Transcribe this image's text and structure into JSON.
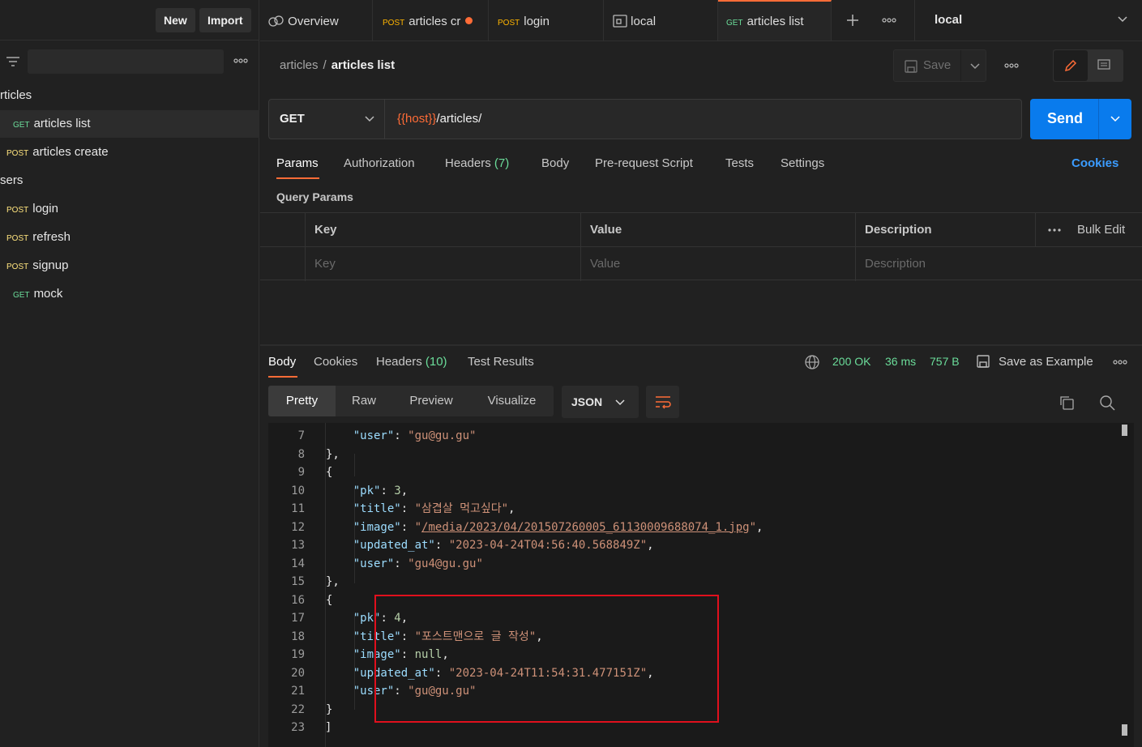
{
  "sidebar": {
    "new_label": "New",
    "import_label": "Import",
    "items": [
      {
        "label": "rticles",
        "method": ""
      },
      {
        "label": "articles list",
        "method": "GET"
      },
      {
        "label": "articles create",
        "method": "POST"
      },
      {
        "label": "sers",
        "method": ""
      },
      {
        "label": "login",
        "method": "POST"
      },
      {
        "label": "refresh",
        "method": "POST"
      },
      {
        "label": "signup",
        "method": "POST"
      },
      {
        "label": "mock",
        "method": "GET"
      }
    ]
  },
  "tabs": [
    {
      "method": "",
      "label": "Overview"
    },
    {
      "method": "POST",
      "label": "articles cr"
    },
    {
      "method": "POST",
      "label": "login"
    },
    {
      "method": "",
      "label": "local"
    },
    {
      "method": "GET",
      "label": "articles list"
    }
  ],
  "environment": "local",
  "breadcrumb": {
    "parent": "articles",
    "separator": "/",
    "current": "articles list"
  },
  "request": {
    "save_label": "Save",
    "method": "GET",
    "url_var": "{{host}}",
    "url_path": "/articles/",
    "send_label": "Send",
    "tabs": [
      "Params",
      "Authorization",
      "Headers",
      "(7)",
      "Body",
      "Pre-request Script",
      "Tests",
      "Settings"
    ],
    "cookies_label": "Cookies",
    "query_params_title": "Query Params",
    "table": {
      "headers": [
        "Key",
        "Value",
        "Description"
      ],
      "bulk_edit": "Bulk Edit",
      "placeholders": [
        "Key",
        "Value",
        "Description"
      ]
    }
  },
  "response": {
    "tabs": [
      "Body",
      "Cookies",
      "Headers",
      "(10)",
      "Test Results"
    ],
    "status": "200 OK",
    "time": "36 ms",
    "size": "757 B",
    "save_example": "Save as Example",
    "views": [
      "Pretty",
      "Raw",
      "Preview",
      "Visualize"
    ],
    "format": "JSON"
  },
  "code": {
    "line_numbers": [
      "7",
      "8",
      "9",
      "10",
      "11",
      "12",
      "13",
      "14",
      "15",
      "16",
      "17",
      "18",
      "19",
      "20",
      "21",
      "22",
      "23"
    ],
    "user1": "\"gu@gu.gu\"",
    "pk3": "3",
    "title3": "\"삼겹살 먹고싶다\"",
    "image3": "/media/2023/04/201507260005_61130009688074_1.jpg",
    "updated3": "\"2023-04-24T04:56:40.568849Z\"",
    "user3": "\"gu4@gu.gu\"",
    "pk4": "4",
    "title4": "\"포스트맨으로 글 작성\"",
    "image4": "null",
    "updated4": "\"2023-04-24T11:54:31.477151Z\"",
    "user4": "\"gu@gu.gu\"",
    "keys": {
      "user": "\"user\"",
      "pk": "\"pk\"",
      "title": "\"title\"",
      "image": "\"image\"",
      "updated_at": "\"updated_at\""
    }
  }
}
